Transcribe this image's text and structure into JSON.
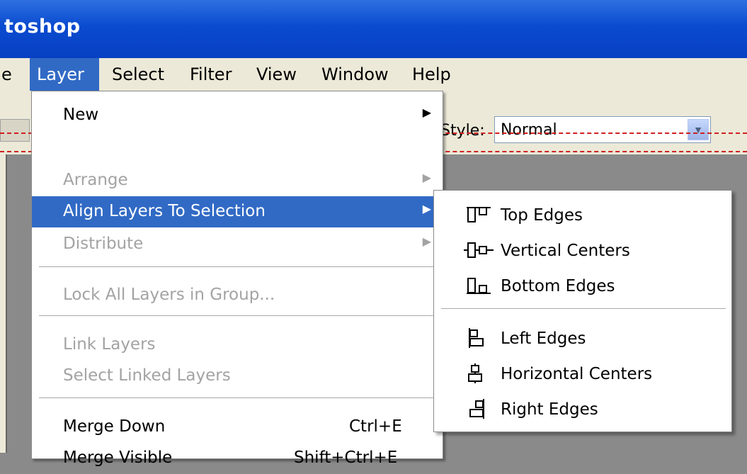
{
  "window": {
    "title_fragment": "toshop"
  },
  "menubar": {
    "items": [
      {
        "label": "e",
        "active": false
      },
      {
        "label": "Layer",
        "active": true
      },
      {
        "label": "Select",
        "active": false
      },
      {
        "label": "Filter",
        "active": false
      },
      {
        "label": "View",
        "active": false
      },
      {
        "label": "Window",
        "active": false
      },
      {
        "label": "Help",
        "active": false
      }
    ]
  },
  "options": {
    "style_label": "Style:",
    "style_value": "Normal"
  },
  "layer_menu": {
    "new": "New",
    "arrange": "Arrange",
    "align": "Align Layers To Selection",
    "distribute": "Distribute",
    "lock_all": "Lock All Layers in Group...",
    "link_layers": "Link Layers",
    "select_linked": "Select Linked Layers",
    "merge_down": "Merge Down",
    "merge_down_shortcut": "Ctrl+E",
    "merge_visible_partial": "Merge Visible",
    "merge_visible_shortcut_partial": "Shift+Ctrl+E"
  },
  "align_submenu": {
    "top_edges": "Top Edges",
    "vertical_centers": "Vertical Centers",
    "bottom_edges": "Bottom Edges",
    "left_edges": "Left Edges",
    "horizontal_centers": "Horizontal Centers",
    "right_edges": "Right Edges"
  },
  "colors": {
    "highlight": "#316ac5",
    "titlebar": "#0a4bd0",
    "menubar": "#ece9d8",
    "disabled_text": "#a3a3a3"
  }
}
